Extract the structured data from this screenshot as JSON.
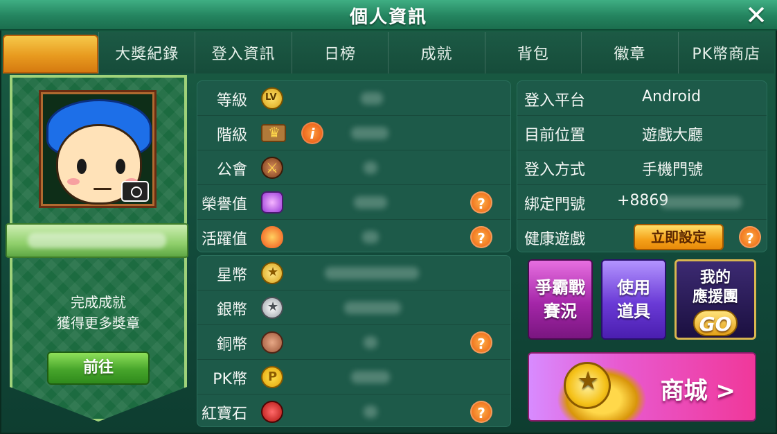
{
  "window": {
    "title": "個人資訊",
    "close_icon": "close-icon"
  },
  "tabs": [
    {
      "label": "大獎紀錄"
    },
    {
      "label": "登入資訊"
    },
    {
      "label": "日榜"
    },
    {
      "label": "成就"
    },
    {
      "label": "背包"
    },
    {
      "label": "徽章"
    },
    {
      "label": "PK幣商店"
    }
  ],
  "profile": {
    "achievement_line1": "完成成就",
    "achievement_line2": "獲得更多獎章",
    "go_button": "前往"
  },
  "stats_top": [
    {
      "label": "等級",
      "icon": "level-icon"
    },
    {
      "label": "階級",
      "icon": "crown-icon"
    },
    {
      "label": "公會",
      "icon": "guild-icon"
    },
    {
      "label": "榮譽值",
      "icon": "honor-icon"
    },
    {
      "label": "活躍值",
      "icon": "fire-icon"
    }
  ],
  "stats_bottom": [
    {
      "label": "星幣",
      "icon": "star-coin-icon"
    },
    {
      "label": "銀幣",
      "icon": "silver-coin-icon"
    },
    {
      "label": "銅幣",
      "icon": "copper-coin-icon"
    },
    {
      "label": "PK幣",
      "icon": "pk-coin-icon"
    },
    {
      "label": "紅寶石",
      "icon": "ruby-icon"
    }
  ],
  "login_info": [
    {
      "label": "登入平台",
      "value": "Android"
    },
    {
      "label": "目前位置",
      "value": "遊戲大廳"
    },
    {
      "label": "登入方式",
      "value": "手機門號"
    },
    {
      "label": "綁定門號",
      "value": "+8869"
    },
    {
      "label": "健康遊戲",
      "button": "立即設定"
    }
  ],
  "features": {
    "war_line1": "爭霸戰",
    "war_line2": "賽況",
    "item_line1": "使用",
    "item_line2": "道具",
    "cheer_line1": "我的",
    "cheer_line2": "應援團",
    "cheer_go": "GO",
    "shop": "商城 >"
  },
  "help_symbol": "?",
  "info_symbol": "i"
}
